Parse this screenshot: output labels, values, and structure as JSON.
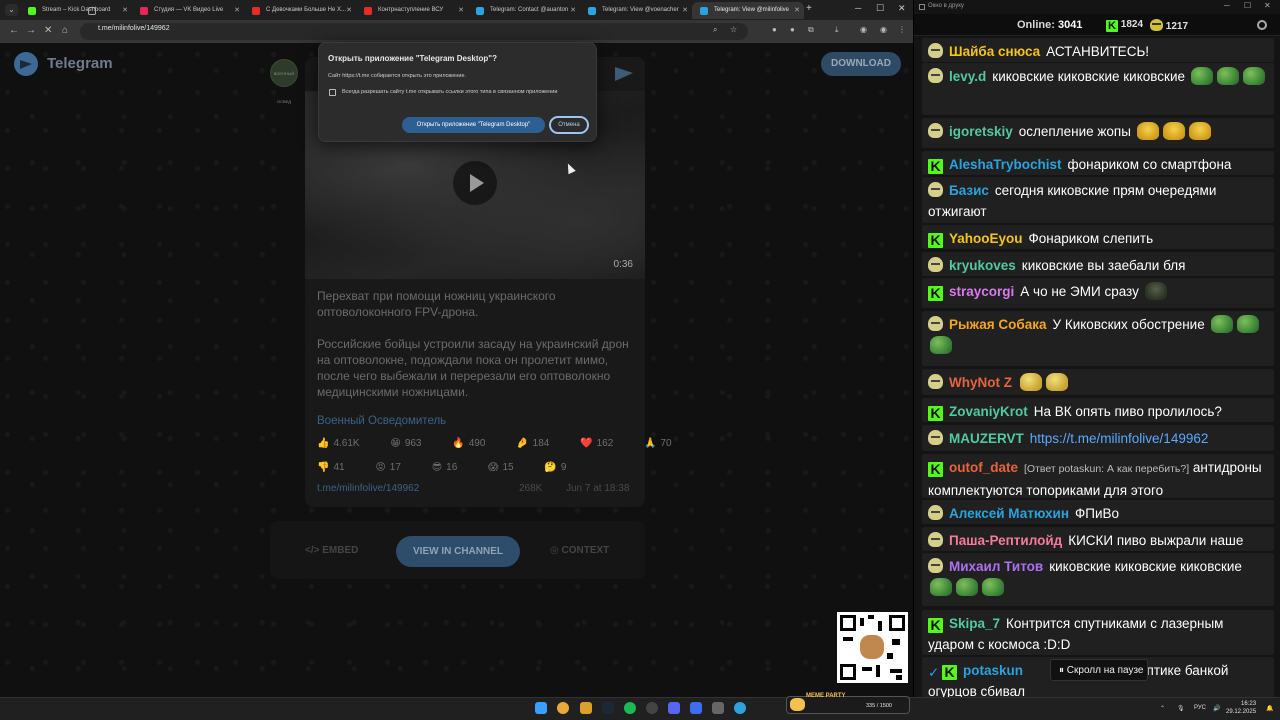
{
  "browser": {
    "tabs": [
      {
        "label": "Stream – Kick Dashboard",
        "color": "#53fc18"
      },
      {
        "label": "Студия — VK Видео Live",
        "color": "#e8265a"
      },
      {
        "label": "С Девочками Больше Не Х...",
        "color": "#e52d27"
      },
      {
        "label": "Контрнаступление ВСУ",
        "color": "#e52d27"
      },
      {
        "label": "Telegram: Contact @auanton",
        "color": "#2aa3df"
      },
      {
        "label": "Telegram: View @voenacher",
        "color": "#2aa3df"
      },
      {
        "label": "Telegram: View @milinfolive",
        "color": "#2aa3df"
      }
    ],
    "url": "t.me/milinfolive/149962"
  },
  "telegram": {
    "brand": "Telegram",
    "download_label": "DOWNLOAD",
    "channel_avatar_text": "ВОЕННЫЙ ОСВЕД",
    "video_duration": "0:36",
    "post_paragraphs": [
      "Перехват при помощи ножниц украинского оптоволоконного FPV-дрона.",
      "Российские бойцы устроили засаду на украинский дрон на оптоволокне, подождали пока он пролетит мимо, после чего выбежали и перерезали его оптоволокно медицинскими ножницами."
    ],
    "author": "Военный Осведомитель",
    "reactions_row1": [
      {
        "emoji": "👍",
        "count": "4.61K"
      },
      {
        "emoji": "😁",
        "count": "963"
      },
      {
        "emoji": "🔥",
        "count": "490"
      },
      {
        "emoji": "🤌",
        "count": "184"
      },
      {
        "emoji": "❤️",
        "count": "162"
      },
      {
        "emoji": "🙏",
        "count": "70"
      }
    ],
    "reactions_row2": [
      {
        "emoji": "👎",
        "count": "41"
      },
      {
        "emoji": "😡",
        "count": "17"
      },
      {
        "emoji": "😎",
        "count": "16"
      },
      {
        "emoji": "😱",
        "count": "15"
      },
      {
        "emoji": "🤔",
        "count": "9"
      }
    ],
    "post_link": "t.me/milinfolive/149962",
    "views": "268K",
    "date": "Jun 7 at 18:38",
    "embed_label": "EMBED",
    "view_channel_label": "VIEW IN CHANNEL",
    "context_label": "CONTEXT"
  },
  "dialog": {
    "title": "Открыть приложение \"Telegram Desktop\"?",
    "text": "Сайт https://t.me собирается открыть это приложение.",
    "checkbox_label": "Всегда разрешать сайту t.me открывать ссылки этого типа в связанном приложении",
    "open_label": "Открыть приложение \"Telegram Desktop\"",
    "cancel_label": "Отмена"
  },
  "chat": {
    "window_title": "Окно в друку",
    "online_label": "Online:",
    "online_count": "3041",
    "kick_count": "1824",
    "vk_count": "1217",
    "pause_label": "Скролл на паузе",
    "messages": [
      {
        "badge": "vk",
        "user": "Шайба снюса",
        "color": "#f5c518",
        "text": "АСТАНВИТЕСЬ!"
      },
      {
        "badge": "vk",
        "user": "levy.d",
        "color": "#53fc18",
        "text": "киковские  киковские  киковские"
      },
      {
        "badge": "vk",
        "user": "igoretskiy",
        "color": "#53fc18",
        "text": "ослепление жопы"
      },
      {
        "badge": "k",
        "user": "AleshaTrybochist",
        "color": "#2aa3df",
        "text": "фонариком со смартфона"
      },
      {
        "badge": "vk",
        "user": "Базис",
        "color": "#2aa3df",
        "text": "сегодня киковские прям очередями отжигают"
      },
      {
        "badge": "k",
        "user": "YahooEyou",
        "color": "#f5c518",
        "text": "Фонариком слепить"
      },
      {
        "badge": "vk",
        "user": "kryukoves",
        "color": "#53fc18",
        "text": "киковские вы заебали бля"
      },
      {
        "badge": "k",
        "user": "straycorgi",
        "color": "#d77af0",
        "text": "А чо не ЭМИ сразу"
      },
      {
        "badge": "vk",
        "user": "Рыжая Собака",
        "color": "#f5a623",
        "text": "У Киковских обострение"
      },
      {
        "badge": "vk",
        "user": "WhyNot Z",
        "color": "#e8643c",
        "text": ""
      },
      {
        "badge": "k",
        "user": "ZovaniyKrot",
        "color": "#53fc18",
        "text": "На ВК опять пиво пролилось?"
      },
      {
        "badge": "vk",
        "user": "MAUZERVT",
        "color": "#53fc18",
        "text": "",
        "link": "https://t.me/milinfolive/149962"
      },
      {
        "badge": "k",
        "user": "outof_date",
        "color": "#e8643c",
        "reply": "[Ответ potaskun: А как перебить?]",
        "text": "антидроны комплектуются топориками для этого"
      },
      {
        "badge": "vk",
        "user": "Алексей Матюхин",
        "color": "#2aa3df",
        "text": "ФПиВо"
      },
      {
        "badge": "vk",
        "user": "Паша-Рептилойд",
        "color": "#f57b9a",
        "text": "КИСКИ пиво выжрали наше"
      },
      {
        "badge": "vk",
        "user": "Михаил Титов",
        "color": "#b06ff0",
        "text": "киковские  киковские  киковские"
      },
      {
        "badge": "k",
        "user": "Skipa_7",
        "color": "#53fc18",
        "text": "Контрится спутниками с лазерным ударом с космоса :D:D"
      },
      {
        "badge": "k",
        "user": "potaskun",
        "color": "#2aa3df",
        "text": "оптике банкой огурцов сбивал"
      }
    ]
  },
  "taskbar": {
    "meme_title": "MEME PARTY",
    "meme_count": "335 / 1500",
    "lang": "РУС",
    "time": "16:23",
    "date": "29.12.2025"
  }
}
